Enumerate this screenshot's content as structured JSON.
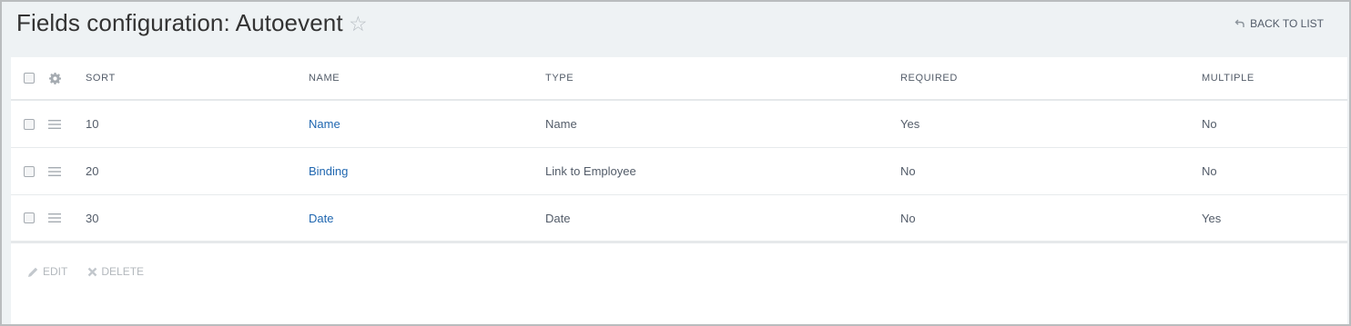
{
  "header": {
    "title": "Fields configuration: Autoevent",
    "star_icon": "star-outline-icon",
    "back_label": "BACK TO LIST",
    "back_icon": "return-arrow-icon"
  },
  "table": {
    "columns": [
      "SORT",
      "NAME",
      "TYPE",
      "REQUIRED",
      "MULTIPLE"
    ],
    "rows": [
      {
        "sort": "10",
        "name": "Name",
        "type": "Name",
        "required": "Yes",
        "multiple": "No"
      },
      {
        "sort": "20",
        "name": "Binding",
        "type": "Link to Employee",
        "required": "No",
        "multiple": "No"
      },
      {
        "sort": "30",
        "name": "Date",
        "type": "Date",
        "required": "No",
        "multiple": "Yes"
      }
    ]
  },
  "footer": {
    "edit_label": "EDIT",
    "delete_label": "DELETE"
  },
  "colors": {
    "background": "#eef2f4",
    "link": "#2067b0",
    "text": "#535c69",
    "muted": "#b3b8bd"
  }
}
